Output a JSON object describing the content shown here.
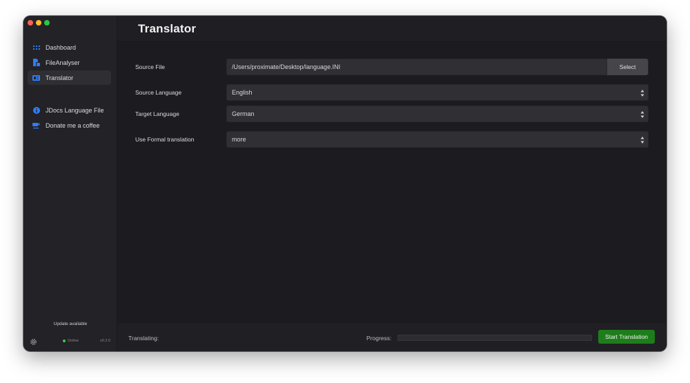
{
  "window": {
    "title": "Translator"
  },
  "sidebar": {
    "items": [
      {
        "label": "Dashboard",
        "icon": "grid-icon"
      },
      {
        "label": "FileAnalyser",
        "icon": "file-analyser-icon"
      },
      {
        "label": "Translator",
        "icon": "translator-icon",
        "active": true
      }
    ],
    "links": [
      {
        "label": "JDocs Language File",
        "icon": "info-icon"
      },
      {
        "label": "Donate me a coffee",
        "icon": "coffee-icon"
      }
    ],
    "update_text": "Update available",
    "status": "Online",
    "version": "v0.2.0"
  },
  "form": {
    "source_file": {
      "label": "Source File",
      "value": "/Users/proximate/Desktop/language.INI",
      "button": "Select"
    },
    "source_language": {
      "label": "Source Language",
      "value": "English"
    },
    "target_language": {
      "label": "Target Language",
      "value": "German"
    },
    "formal": {
      "label": "Use Formal translation",
      "value": "more"
    }
  },
  "footer": {
    "translating_label": "Translating:",
    "progress_label": "Progress:",
    "progress_value": 0,
    "start_button": "Start Translation"
  },
  "colors": {
    "accent_blue": "#2f7df6",
    "button_green": "#1e7d1b",
    "status_green": "#2fd14b"
  }
}
